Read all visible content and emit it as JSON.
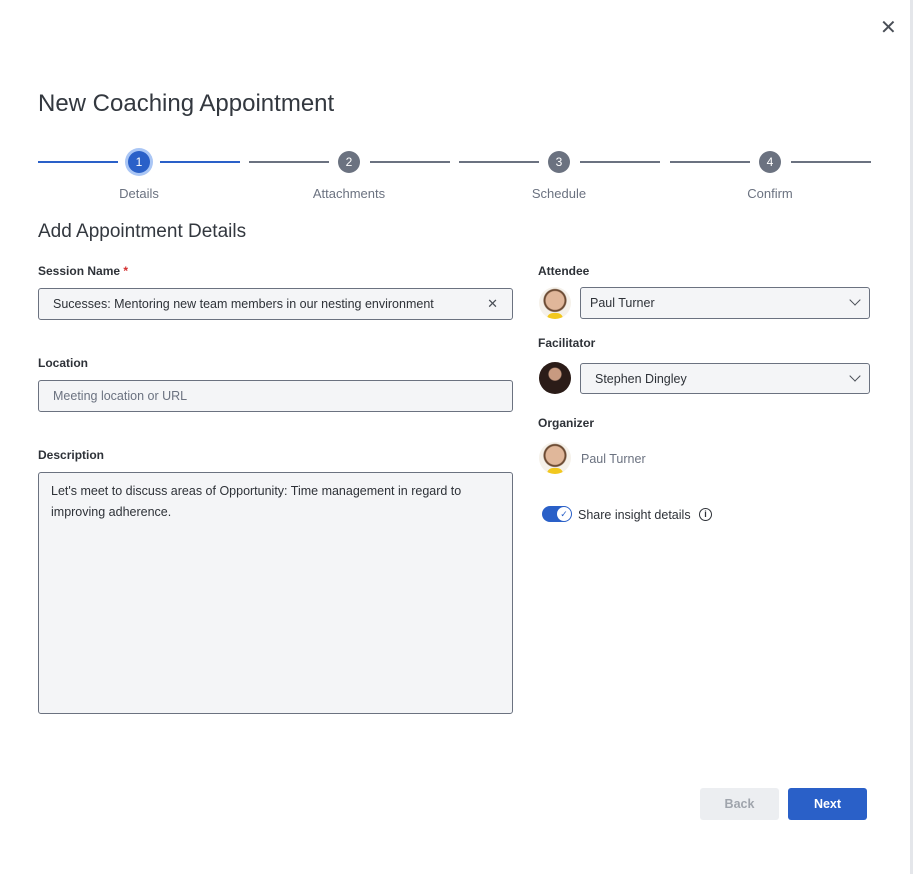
{
  "dialog": {
    "title": "New Coaching Appointment",
    "close_icon": "close-icon"
  },
  "stepper": [
    {
      "num": "1",
      "label": "Details",
      "active": true
    },
    {
      "num": "2",
      "label": "Attachments"
    },
    {
      "num": "3",
      "label": "Schedule"
    },
    {
      "num": "4",
      "label": "Confirm"
    }
  ],
  "section_title": "Add Appointment Details",
  "session": {
    "label": "Session Name",
    "required": "*",
    "value": "Sucesses: Mentoring new team members in our nesting environment"
  },
  "location": {
    "label": "Location",
    "placeholder": "Meeting location or URL"
  },
  "description": {
    "label": "Description",
    "value": "Let's meet to discuss areas of Opportunity: Time management in regard to improving adherence."
  },
  "attendee": {
    "label": "Attendee",
    "value": "Paul Turner"
  },
  "facilitator": {
    "label": "Facilitator",
    "value": "Stephen Dingley"
  },
  "organizer": {
    "label": "Organizer",
    "value": "Paul Turner"
  },
  "share": {
    "label": "Share insight details",
    "on": true
  },
  "buttons": {
    "back": "Back",
    "next": "Next"
  },
  "colors": {
    "accent": "#2a60c8"
  }
}
